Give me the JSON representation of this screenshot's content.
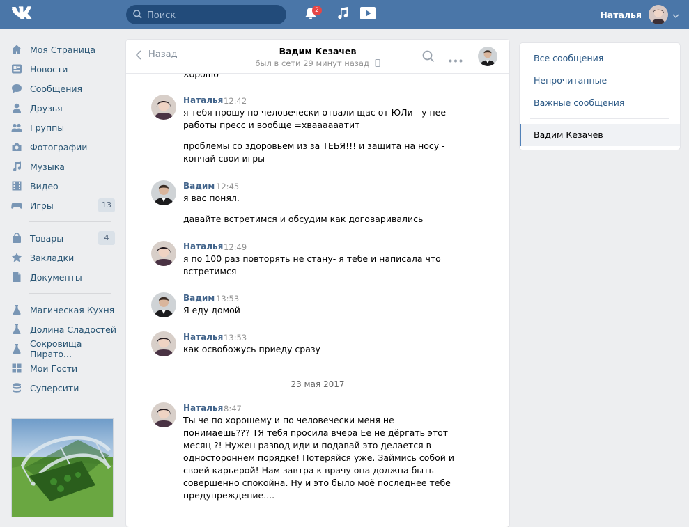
{
  "header": {
    "logo": "VK",
    "search_placeholder": "Поиск",
    "notifications_count": "2",
    "user_name": "Наталья"
  },
  "left_nav": {
    "main": [
      {
        "label": "Моя Страница",
        "icon": "home-icon"
      },
      {
        "label": "Новости",
        "icon": "news-icon"
      },
      {
        "label": "Сообщения",
        "icon": "messages-icon"
      },
      {
        "label": "Друзья",
        "icon": "friends-icon"
      },
      {
        "label": "Группы",
        "icon": "groups-icon"
      },
      {
        "label": "Фотографии",
        "icon": "camera-icon"
      },
      {
        "label": "Музыка",
        "icon": "music-icon"
      },
      {
        "label": "Видео",
        "icon": "video-icon"
      },
      {
        "label": "Игры",
        "icon": "gamepad-icon",
        "count": "13"
      }
    ],
    "shop": [
      {
        "label": "Товары",
        "icon": "bag-icon",
        "count": "4"
      },
      {
        "label": "Закладки",
        "icon": "star-icon"
      },
      {
        "label": "Документы",
        "icon": "document-icon"
      }
    ],
    "apps": [
      {
        "label": "Магическая Кухня",
        "icon": "flask-icon"
      },
      {
        "label": "Долина Сладостей",
        "icon": "flask-icon"
      },
      {
        "label": "Сокровища Пирато...",
        "icon": "flask-icon"
      },
      {
        "label": "Мои Гости",
        "icon": "grid-icon"
      },
      {
        "label": "Суперсити",
        "icon": "coins-icon"
      }
    ]
  },
  "chat": {
    "back_label": "Назад",
    "peer_name": "Вадим Кезачев",
    "peer_status": "был в сети 29 минут назад",
    "previous_text": "Хорошо",
    "messages": [
      {
        "author": "Наталья",
        "time": "12:42",
        "paragraphs": [
          "я тебя прошу по человечески отвали щас от ЮЛи - у нее работы пресс и вообще =хваааааатит",
          "проблемы со здоровьем из за ТЕБЯ!!! и защита на носу - кончай свои игры"
        ]
      },
      {
        "author": "Вадим",
        "time": "12:45",
        "paragraphs": [
          "я вас понял.",
          "давайте встретимся и обсудим как договаривались"
        ]
      },
      {
        "author": "Наталья",
        "time": "12:49",
        "paragraphs": [
          "я по 100 раз повторять не стану- я тебе и написала что встретимся"
        ]
      },
      {
        "author": "Вадим",
        "time": "13:53",
        "paragraphs": [
          "Я еду домой"
        ]
      },
      {
        "author": "Наталья",
        "time": "13:53",
        "paragraphs": [
          "как освобожусь приеду сразу"
        ]
      },
      {
        "author": "Наталья",
        "time": "8:47",
        "paragraphs": [
          "Ты че по хорошему и по человечески меня не понимаешь??? ТЯ тебя просила вчера Ее не дёргать этот месяц ?! Нужен развод иди и подавай это делается в одностороннем порядке! Потеряйся уже. Займись собой и своей карьерой! Нам завтра к врачу она должна быть совершенно спокойна. Ну и это было моё последнее тебе предупреждение...."
        ]
      }
    ],
    "date_separator": "23 мая 2017"
  },
  "right_nav": {
    "items": [
      "Все сообщения",
      "Непрочитанные",
      "Важные сообщения"
    ],
    "active": "Вадим Кезачев"
  },
  "colors": {
    "header": "#4a76a8",
    "link": "#2a5885",
    "author": "#42648b",
    "badge": "#e64646"
  }
}
